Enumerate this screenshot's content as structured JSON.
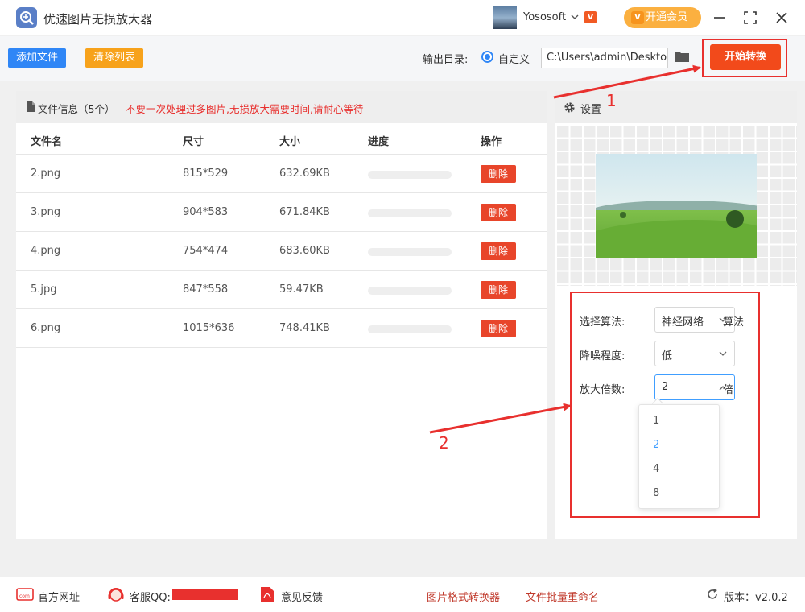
{
  "app": {
    "title": "优速图片无损放大器",
    "username": "Yososoft",
    "vip_badge": "V",
    "vip_button": "开通会员"
  },
  "toolbar": {
    "add_files": "添加文件",
    "clear_list": "清除列表",
    "output_dir_label": "输出目录:",
    "radio_custom": "自定义",
    "output_path": "C:\\Users\\admin\\Deskto",
    "start_button": "开始转换"
  },
  "file_panel": {
    "info_label": "文件信息（5个）",
    "warning": "不要一次处理过多图片,无损放大需要时间,请耐心等待",
    "columns": [
      "文件名",
      "尺寸",
      "大小",
      "进度",
      "操作"
    ],
    "rows": [
      {
        "name": "2.png",
        "size": "815*529",
        "filesize": "632.69KB",
        "progress": 0,
        "action": "删除"
      },
      {
        "name": "3.png",
        "size": "904*583",
        "filesize": "671.84KB",
        "progress": 0,
        "action": "删除"
      },
      {
        "name": "4.png",
        "size": "754*474",
        "filesize": "683.60KB",
        "progress": 0,
        "action": "删除"
      },
      {
        "name": "5.jpg",
        "size": "847*558",
        "filesize": "59.47KB",
        "progress": 0,
        "action": "删除"
      },
      {
        "name": "6.png",
        "size": "1015*636",
        "filesize": "748.41KB",
        "progress": 0,
        "action": "删除"
      }
    ]
  },
  "settings": {
    "title": "设置",
    "algorithm_label": "选择算法:",
    "algorithm_value": "神经网络",
    "algorithm_suffix": "算法",
    "denoise_label": "降噪程度:",
    "denoise_value": "低",
    "scale_label": "放大倍数:",
    "scale_value": "2",
    "scale_suffix": "倍",
    "scale_options": [
      "1",
      "2",
      "4",
      "8"
    ],
    "scale_selected_index": 1
  },
  "annotations": {
    "step1": "1",
    "step2": "2",
    "color": "#e8302e"
  },
  "footer": {
    "website": "官方网址",
    "qq": "客服QQ:",
    "feedback": "意见反馈",
    "format_converter": "图片格式转换器",
    "batch_rename": "文件批量重命名",
    "version": "版本：v2.0.2"
  },
  "icons": [
    "app-logo-icon",
    "chevron-down-icon",
    "minimize-icon",
    "maximize-icon",
    "close-icon",
    "folder-icon",
    "document-icon",
    "gear-icon",
    "com-icon",
    "headset-icon",
    "pdf-icon",
    "refresh-icon"
  ]
}
